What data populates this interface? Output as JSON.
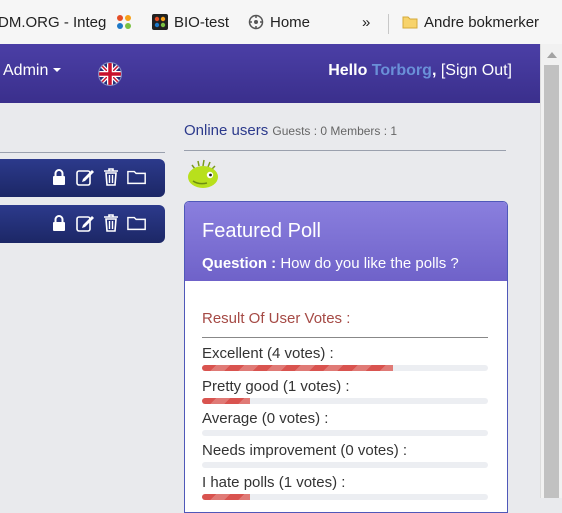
{
  "bookmarks": {
    "items": [
      {
        "label": "DM.ORG - Integ"
      },
      {
        "label": "BIO-test"
      },
      {
        "label": "Home"
      }
    ],
    "overflow": "»",
    "other": "Andre bokmerker"
  },
  "header": {
    "admin_label": "Admin",
    "hello": "Hello",
    "username": "Torborg",
    "comma": ",",
    "signout": "[Sign Out]"
  },
  "online": {
    "title": "Online users",
    "stats": "Guests : 0 Members : 1"
  },
  "poll": {
    "title": "Featured Poll",
    "question_label": "Question :",
    "question": "How do you like the polls ?",
    "result_title": "Result Of User Votes :",
    "options": [
      {
        "label": "Excellent (4 votes) :",
        "percent": 66.7
      },
      {
        "label": "Pretty good (1 votes) :",
        "percent": 16.7
      },
      {
        "label": "Average (0 votes) :",
        "percent": 0
      },
      {
        "label": "Needs improvement (0 votes) :",
        "percent": 0
      },
      {
        "label": "I hate polls (1 votes) :",
        "percent": 16.7
      }
    ]
  },
  "colors": {
    "header": "#3f3496",
    "poll_header": "#7e72d6",
    "bar": "#d9534f",
    "username": "#6a90d8"
  }
}
